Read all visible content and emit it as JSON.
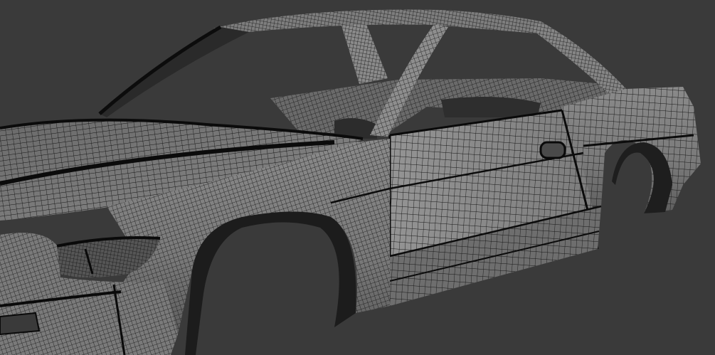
{
  "viewport": {
    "background": "#3a3a3a",
    "body_color": "#8e8e8e",
    "body_shadow": "#5c5c5c",
    "wire_color": "#151515",
    "edge_color": "#0a0a0a"
  },
  "model": {
    "parts": [
      "hood",
      "front-fender",
      "headlight",
      "front-bumper",
      "windshield-frame",
      "roof",
      "b-pillar",
      "c-pillar",
      "door",
      "door-handle",
      "rocker-panel",
      "rear-quarter-panel",
      "rear-wheel-arch",
      "front-wheel-arch",
      "interior"
    ]
  }
}
